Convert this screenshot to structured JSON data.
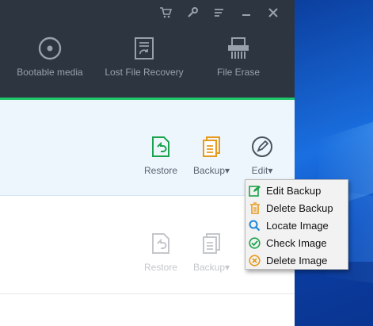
{
  "window": {
    "toolbar": {
      "items": [
        {
          "label": "Bootable media",
          "icon": "disc-icon"
        },
        {
          "label": "Lost File Recovery",
          "icon": "file-recovery-icon"
        },
        {
          "label": "File Erase",
          "icon": "shredder-icon"
        }
      ]
    },
    "title_controls": [
      {
        "name": "cart-icon"
      },
      {
        "name": "wrench-icon"
      },
      {
        "name": "menu-icon"
      },
      {
        "name": "minimize-icon"
      },
      {
        "name": "close-icon"
      }
    ]
  },
  "backups": [
    {
      "active": true,
      "actions": {
        "restore": "Restore",
        "backup": "Backup▾",
        "edit": "Edit▾"
      }
    },
    {
      "active": false,
      "actions": {
        "restore": "Restore",
        "backup": "Backup▾"
      }
    }
  ],
  "context_menu": {
    "items": [
      {
        "label": "Edit Backup",
        "icon": "edit-icon",
        "color": "#1aa34a"
      },
      {
        "label": "Delete Backup",
        "icon": "trash-icon",
        "color": "#e79a1c"
      },
      {
        "label": "Locate Image",
        "icon": "magnifier-icon",
        "color": "#1e88d8"
      },
      {
        "label": "Check Image",
        "icon": "check-circle-icon",
        "color": "#1aa34a"
      },
      {
        "label": "Delete Image",
        "icon": "x-circle-icon",
        "color": "#e79a1c"
      }
    ]
  },
  "colors": {
    "titlebar": "#2d3540",
    "accent_green": "#1fc96b",
    "selected_row": "#eef6fd",
    "menu_bg": "#f2f2f2"
  }
}
